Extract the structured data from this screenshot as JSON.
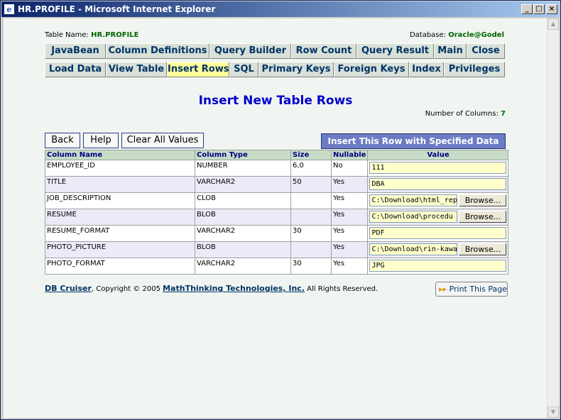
{
  "window": {
    "title": "HR.PROFILE - Microsoft Internet Explorer"
  },
  "header": {
    "table_label": "Table Name:",
    "table_name": "HR.PROFILE",
    "db_label": "Database:",
    "db_name": "Oracle@Godel"
  },
  "nav": {
    "row1": [
      "JavaBean",
      "Column Definitions",
      "Query Builder",
      "Row Count",
      "Query Result",
      "Main",
      "Close"
    ],
    "row2": [
      "Load Data",
      "View Table",
      "Insert Rows",
      "SQL",
      "Primary Keys",
      "Foreign Keys",
      "Index",
      "Privileges"
    ]
  },
  "page": {
    "heading": "Insert New Table Rows",
    "num_cols_label": "Number of Columns:",
    "num_cols": "7"
  },
  "actions": {
    "back": "Back",
    "help": "Help",
    "clear": "Clear All Values",
    "insert": "Insert This Row with Specified Data"
  },
  "table": {
    "headers": [
      "Column Name",
      "Column Type",
      "Size",
      "Nullable",
      "Value"
    ],
    "browse_label": "Browse...",
    "rows": [
      {
        "name": "EMPLOYEE_ID",
        "type": "NUMBER",
        "size": "6,0",
        "nullable": "No",
        "value": "111",
        "file": false
      },
      {
        "name": "TITLE",
        "type": "VARCHAR2",
        "size": "50",
        "nullable": "Yes",
        "value": "DBA",
        "file": false
      },
      {
        "name": "JOB_DESCRIPTION",
        "type": "CLOB",
        "size": "",
        "nullable": "Yes",
        "value": "C:\\Download\\html_rep",
        "file": true
      },
      {
        "name": "RESUME",
        "type": "BLOB",
        "size": "",
        "nullable": "Yes",
        "value": "C:\\Download\\procedu",
        "file": true
      },
      {
        "name": "RESUME_FORMAT",
        "type": "VARCHAR2",
        "size": "30",
        "nullable": "Yes",
        "value": "PDF",
        "file": false
      },
      {
        "name": "PHOTO_PICTURE",
        "type": "BLOB",
        "size": "",
        "nullable": "Yes",
        "value": "C:\\Download\\rin-kawa",
        "file": true
      },
      {
        "name": "PHOTO_FORMAT",
        "type": "VARCHAR2",
        "size": "30",
        "nullable": "Yes",
        "value": "JPG",
        "file": false
      }
    ]
  },
  "footer": {
    "product": "DB Cruiser",
    "copyright": ", Copyright © 2005 ",
    "company": "MathThinking Technologies, Inc.",
    "rights": " All Rights Reserved.",
    "print": "Print This Page"
  }
}
